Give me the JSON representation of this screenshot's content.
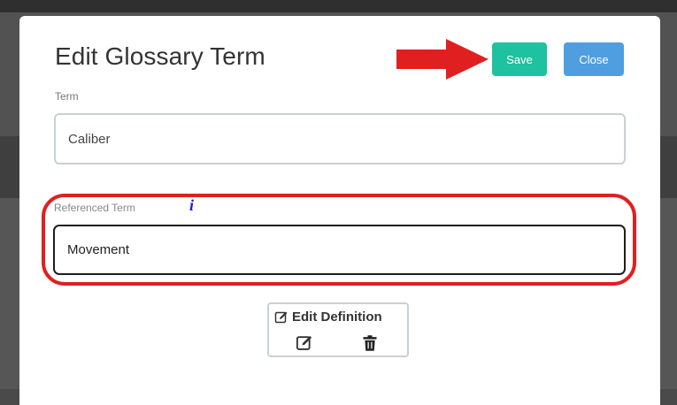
{
  "modal": {
    "title": "Edit Glossary Term",
    "save_label": "Save",
    "close_label": "Close"
  },
  "term": {
    "label": "Term",
    "value": "Caliber"
  },
  "referenced_term": {
    "label": "Referenced Term",
    "info_glyph": "i",
    "value": "Movement"
  },
  "definition": {
    "edit_label": "Edit Definition"
  },
  "icons": {
    "info": "info-icon",
    "edit": "edit-icon",
    "trash": "trash-icon",
    "arrow": "right-arrow-annotation"
  },
  "colors": {
    "save": "#1ec1a0",
    "close": "#4f9ee0",
    "annotation": "#e02020",
    "info": "#1f1fcc"
  }
}
